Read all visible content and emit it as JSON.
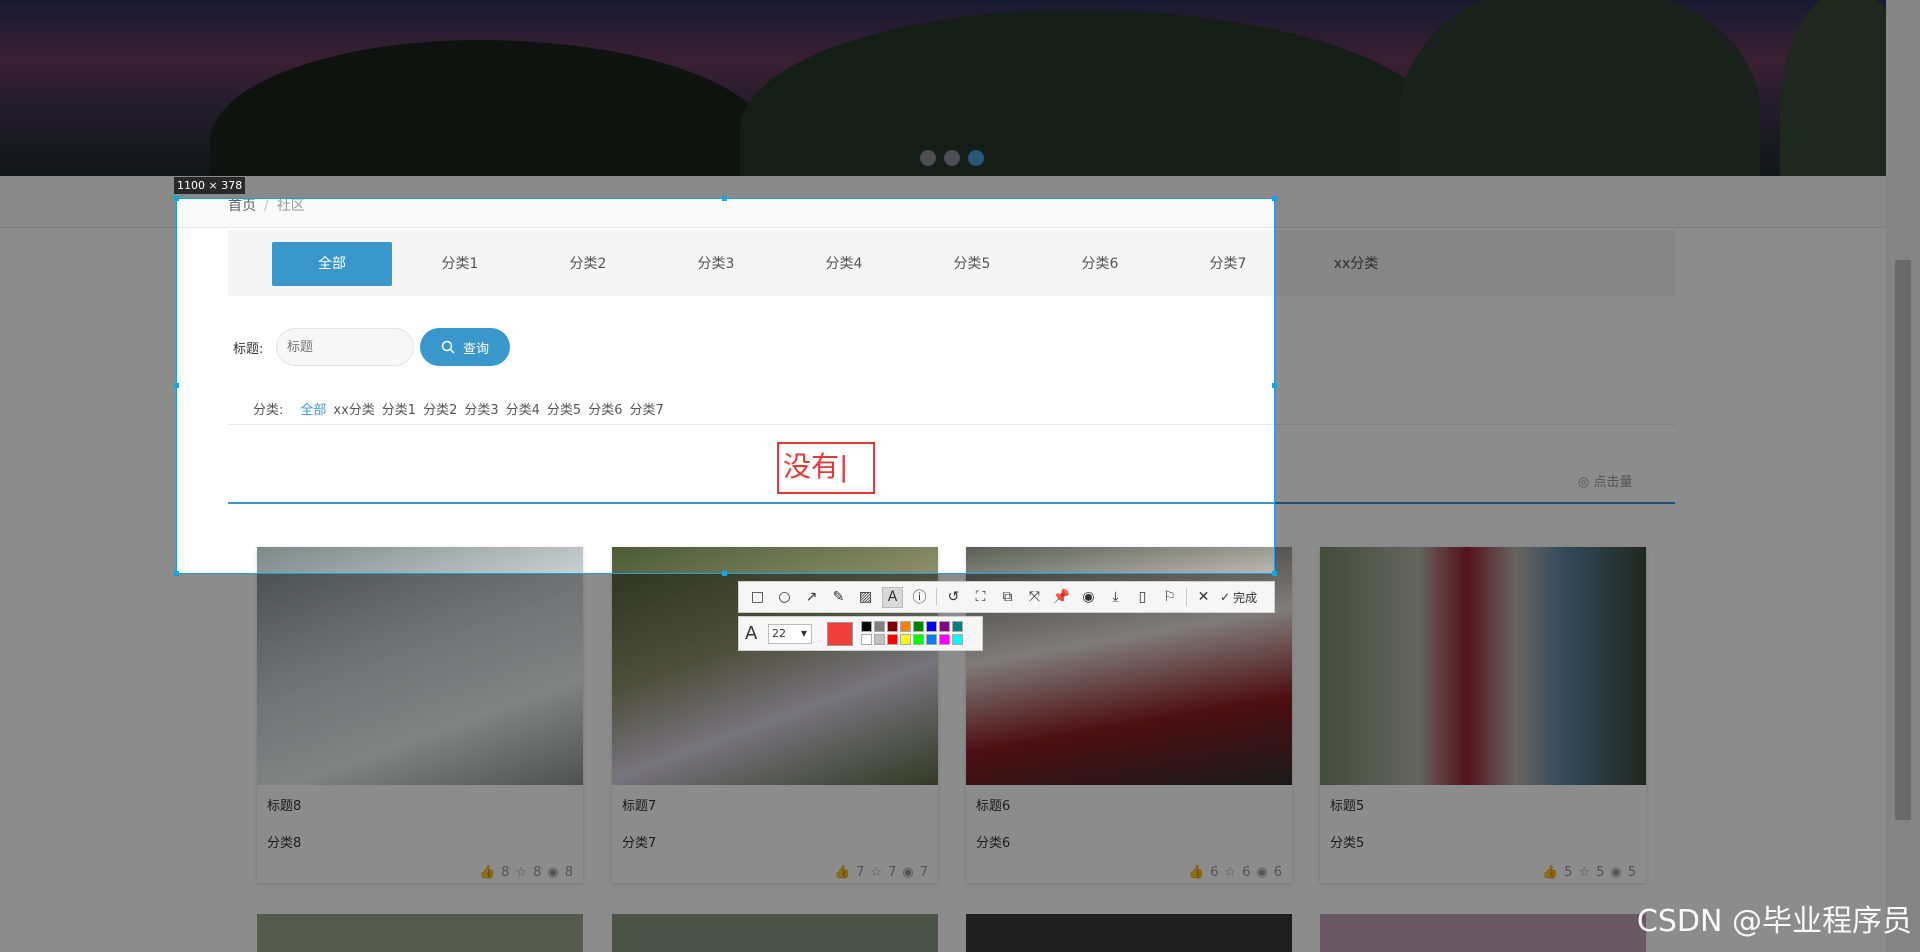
{
  "hero": {
    "dots": 3,
    "active_dot": 3
  },
  "breadcrumb": {
    "home": "首页",
    "separator": "/",
    "current": "社区"
  },
  "tabs": [
    "全部",
    "分类1",
    "分类2",
    "分类3",
    "分类4",
    "分类5",
    "分类6",
    "分类7",
    "xx分类"
  ],
  "active_tab": "全部",
  "search": {
    "label": "标题:",
    "placeholder": "标题",
    "button": "查询"
  },
  "category_filter": {
    "label": "分类:",
    "items": [
      "全部",
      "xx分类",
      "分类1",
      "分类2",
      "分类3",
      "分类4",
      "分类5",
      "分类6",
      "分类7"
    ],
    "active": "全部"
  },
  "sort": {
    "label": "点击量"
  },
  "cards": [
    {
      "title": "标题8",
      "category": "分类8",
      "likes": "8",
      "favorites": "8",
      "views": "8"
    },
    {
      "title": "标题7",
      "category": "分类7",
      "likes": "7",
      "favorites": "7",
      "views": "7"
    },
    {
      "title": "标题6",
      "category": "分类6",
      "likes": "6",
      "favorites": "6",
      "views": "6"
    },
    {
      "title": "标题5",
      "category": "分类5",
      "likes": "5",
      "favorites": "5",
      "views": "5"
    }
  ],
  "screenshot_tool": {
    "selection_size": "1100 × 378",
    "text_annotation": "没有",
    "done_label": "完成",
    "font_size": "22",
    "current_color": "#f23d3d",
    "palette": [
      "#000000",
      "#808080",
      "#800000",
      "#ff8000",
      "#008000",
      "#0000ff",
      "#800080",
      "#008080",
      "#ffffff",
      "#c0c0c0",
      "#ff0000",
      "#ffff00",
      "#00ff00",
      "#0080ff",
      "#ff00ff",
      "#00ffff"
    ]
  },
  "watermark": "CSDN @毕业程序员"
}
